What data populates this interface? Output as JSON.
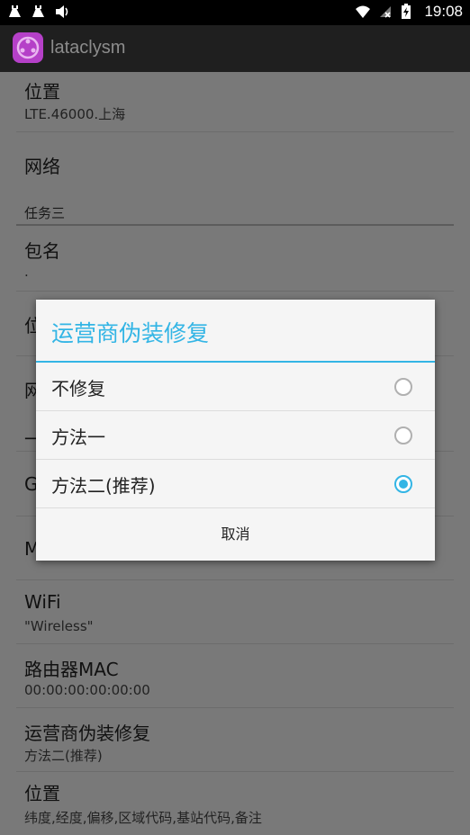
{
  "status_bar": {
    "time": "19:08",
    "icons": [
      "android-debug-icon",
      "android-debug-icon",
      "volume-icon",
      "wifi-icon",
      "no-sim-icon",
      "battery-charging-icon"
    ]
  },
  "app": {
    "title": "lataclysm",
    "icon": "app-logo-icon"
  },
  "list": {
    "item1_title": "位置",
    "item1_summary": "LTE.46000.上海",
    "item2_title": "网络",
    "category": "任务三",
    "item3_title": "包名",
    "item3_summary": ".",
    "item4_title": "位",
    "item5_title": "网",
    "item6_title": "一",
    "item7_title": "G",
    "item8_title": "M",
    "item9_title": "WiFi",
    "item9_summary": "\"Wireless\"",
    "item10_title": "路由器MAC",
    "item10_summary": "00:00:00:00:00:00",
    "item11_title": "运营商伪装修复",
    "item11_summary": "方法二(推荐)",
    "item12_title": "位置",
    "item12_summary": "纬度,经度,偏移,区域代码,基站代码,备注"
  },
  "dialog": {
    "title": "运营商伪装修复",
    "options": [
      {
        "label": "不修复",
        "selected": false
      },
      {
        "label": "方法一",
        "selected": false
      },
      {
        "label": "方法二(推荐)",
        "selected": true
      }
    ],
    "cancel_label": "取消"
  },
  "colors": {
    "accent": "#33b5e5",
    "app_icon": "#b540c8"
  }
}
